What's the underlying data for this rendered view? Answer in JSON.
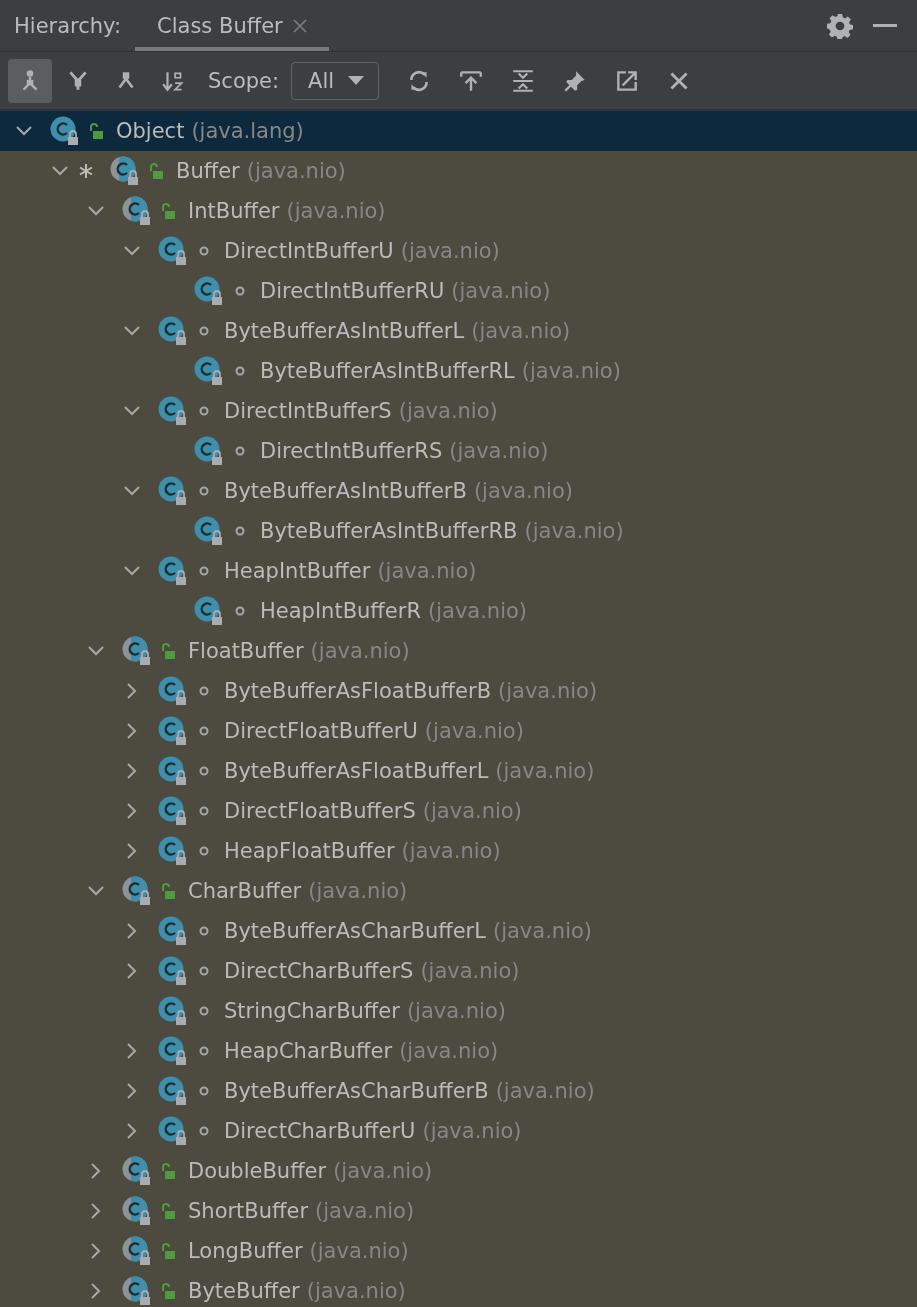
{
  "header": {
    "label": "Hierarchy:",
    "tabs": [
      {
        "label": "Class Buffer",
        "selected": true,
        "closable": true
      }
    ]
  },
  "toolbar": {
    "buttons": [
      {
        "kind": "subtypes",
        "selected": true
      },
      {
        "kind": "supertypes",
        "selected": false
      },
      {
        "kind": "hierarchy",
        "selected": false
      },
      {
        "kind": "sort",
        "selected": false
      }
    ],
    "scope_label": "Scope:",
    "scope_value": "All",
    "actions": [
      {
        "kind": "refresh"
      },
      {
        "kind": "export"
      },
      {
        "kind": "expand"
      },
      {
        "kind": "pin"
      },
      {
        "kind": "open"
      },
      {
        "kind": "close"
      }
    ]
  },
  "tree": [
    {
      "name": "Object",
      "package": "(java.lang)",
      "kind": "class",
      "public": true,
      "expanded": true,
      "selected": true,
      "children": [
        {
          "name": "Buffer",
          "package": "(java.nio)",
          "kind": "abstract",
          "public": true,
          "expanded": true,
          "selected": false,
          "marked": true,
          "children": [
            {
              "name": "IntBuffer",
              "package": "(java.nio)",
              "kind": "abstract",
              "public": true,
              "expanded": true,
              "selected": false,
              "children": [
                {
                  "name": "DirectIntBufferU",
                  "package": "(java.nio)",
                  "kind": "class",
                  "public": false,
                  "expanded": true,
                  "selected": false,
                  "children": [
                    {
                      "name": "DirectIntBufferRU",
                      "package": "(java.nio)",
                      "kind": "class",
                      "public": false,
                      "selected": false
                    }
                  ]
                },
                {
                  "name": "ByteBufferAsIntBufferL",
                  "package": "(java.nio)",
                  "kind": "class",
                  "public": false,
                  "expanded": true,
                  "selected": false,
                  "children": [
                    {
                      "name": "ByteBufferAsIntBufferRL",
                      "package": "(java.nio)",
                      "kind": "class",
                      "public": false,
                      "selected": false
                    }
                  ]
                },
                {
                  "name": "DirectIntBufferS",
                  "package": "(java.nio)",
                  "kind": "class",
                  "public": false,
                  "expanded": true,
                  "selected": false,
                  "children": [
                    {
                      "name": "DirectIntBufferRS",
                      "package": "(java.nio)",
                      "kind": "class",
                      "public": false,
                      "selected": false
                    }
                  ]
                },
                {
                  "name": "ByteBufferAsIntBufferB",
                  "package": "(java.nio)",
                  "kind": "class",
                  "public": false,
                  "expanded": true,
                  "selected": false,
                  "children": [
                    {
                      "name": "ByteBufferAsIntBufferRB",
                      "package": "(java.nio)",
                      "kind": "class",
                      "public": false,
                      "selected": false
                    }
                  ]
                },
                {
                  "name": "HeapIntBuffer",
                  "package": "(java.nio)",
                  "kind": "class",
                  "public": false,
                  "expanded": true,
                  "selected": false,
                  "children": [
                    {
                      "name": "HeapIntBufferR",
                      "package": "(java.nio)",
                      "kind": "class",
                      "public": false,
                      "selected": false
                    }
                  ]
                }
              ]
            },
            {
              "name": "FloatBuffer",
              "package": "(java.nio)",
              "kind": "abstract",
              "public": true,
              "expanded": true,
              "selected": false,
              "children": [
                {
                  "name": "ByteBufferAsFloatBufferB",
                  "package": "(java.nio)",
                  "kind": "class",
                  "public": false,
                  "expanded": false,
                  "selected": false
                },
                {
                  "name": "DirectFloatBufferU",
                  "package": "(java.nio)",
                  "kind": "class",
                  "public": false,
                  "expanded": false,
                  "selected": false
                },
                {
                  "name": "ByteBufferAsFloatBufferL",
                  "package": "(java.nio)",
                  "kind": "class",
                  "public": false,
                  "expanded": false,
                  "selected": false
                },
                {
                  "name": "DirectFloatBufferS",
                  "package": "(java.nio)",
                  "kind": "class",
                  "public": false,
                  "expanded": false,
                  "selected": false
                },
                {
                  "name": "HeapFloatBuffer",
                  "package": "(java.nio)",
                  "kind": "class",
                  "public": false,
                  "expanded": false,
                  "selected": false
                }
              ]
            },
            {
              "name": "CharBuffer",
              "package": "(java.nio)",
              "kind": "abstract",
              "public": true,
              "expanded": true,
              "selected": false,
              "children": [
                {
                  "name": "ByteBufferAsCharBufferL",
                  "package": "(java.nio)",
                  "kind": "class",
                  "public": false,
                  "expanded": false,
                  "selected": false
                },
                {
                  "name": "DirectCharBufferS",
                  "package": "(java.nio)",
                  "kind": "class",
                  "public": false,
                  "expanded": false,
                  "selected": false
                },
                {
                  "name": "StringCharBuffer",
                  "package": "(java.nio)",
                  "kind": "class",
                  "public": false,
                  "selected": false
                },
                {
                  "name": "HeapCharBuffer",
                  "package": "(java.nio)",
                  "kind": "class",
                  "public": false,
                  "expanded": false,
                  "selected": false
                },
                {
                  "name": "ByteBufferAsCharBufferB",
                  "package": "(java.nio)",
                  "kind": "class",
                  "public": false,
                  "expanded": false,
                  "selected": false
                },
                {
                  "name": "DirectCharBufferU",
                  "package": "(java.nio)",
                  "kind": "class",
                  "public": false,
                  "expanded": false,
                  "selected": false
                }
              ]
            },
            {
              "name": "DoubleBuffer",
              "package": "(java.nio)",
              "kind": "abstract",
              "public": true,
              "expanded": false,
              "selected": false
            },
            {
              "name": "ShortBuffer",
              "package": "(java.nio)",
              "kind": "abstract",
              "public": true,
              "expanded": false,
              "selected": false
            },
            {
              "name": "LongBuffer",
              "package": "(java.nio)",
              "kind": "abstract",
              "public": true,
              "expanded": false,
              "selected": false
            },
            {
              "name": "ByteBuffer",
              "package": "(java.nio)",
              "kind": "abstract",
              "public": true,
              "expanded": false,
              "selected": false
            }
          ]
        }
      ]
    }
  ]
}
